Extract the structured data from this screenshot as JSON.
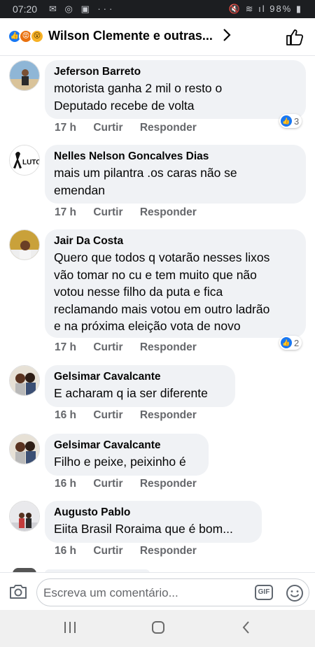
{
  "status_bar": {
    "time": "07:20",
    "left_icons": "✉ ◎ ▣ ···",
    "right_icons": "🔇 ≋ ıl 98% ▮"
  },
  "header": {
    "title": "Wilson Clemente e outras..."
  },
  "comments": [
    {
      "name": "Jeferson Barreto",
      "text": [
        "motorista ganha 2 mil o resto o",
        "Deputado recebe de volta"
      ],
      "time": "17 h",
      "like_label": "Curtir",
      "reply_label": "Responder",
      "likes": "3"
    },
    {
      "name": "Nelles Nelson Goncalves Dias",
      "text": [
        "mais um pilantra .os caras não se",
        "emendan"
      ],
      "time": "17 h",
      "like_label": "Curtir",
      "reply_label": "Responder",
      "avatar_text": "LUTO"
    },
    {
      "name": "Jair Da Costa",
      "text": [
        "Quero que todos q votarão nesses lixos",
        "vão tomar no cu e tem muito que não",
        "votou nesse filho da puta e fica",
        "reclamando mais votou em outro ladrão",
        "e na próxima eleição vota de novo"
      ],
      "time": "17 h",
      "like_label": "Curtir",
      "reply_label": "Responder",
      "likes": "2"
    },
    {
      "name": "Gelsimar Cavalcante",
      "text": [
        "E acharam q ia ser diferente"
      ],
      "time": "16 h",
      "like_label": "Curtir",
      "reply_label": "Responder"
    },
    {
      "name": "Gelsimar Cavalcante",
      "text": [
        "Filho e peixe, peixinho é"
      ],
      "time": "16 h",
      "like_label": "Curtir",
      "reply_label": "Responder"
    },
    {
      "name": "Augusto Pablo",
      "text": [
        "Eiita Brasil Roraima que é bom..."
      ],
      "time": "16 h",
      "like_label": "Curtir",
      "reply_label": "Responder"
    }
  ],
  "composer": {
    "placeholder": "Escreva um comentário...",
    "gif_label": "GIF"
  },
  "nav": {
    "recents": "|||",
    "home": "○",
    "back": "<"
  },
  "colors": {
    "accent": "#1877f2",
    "bubble": "#f0f2f5",
    "meta": "#65676b"
  }
}
